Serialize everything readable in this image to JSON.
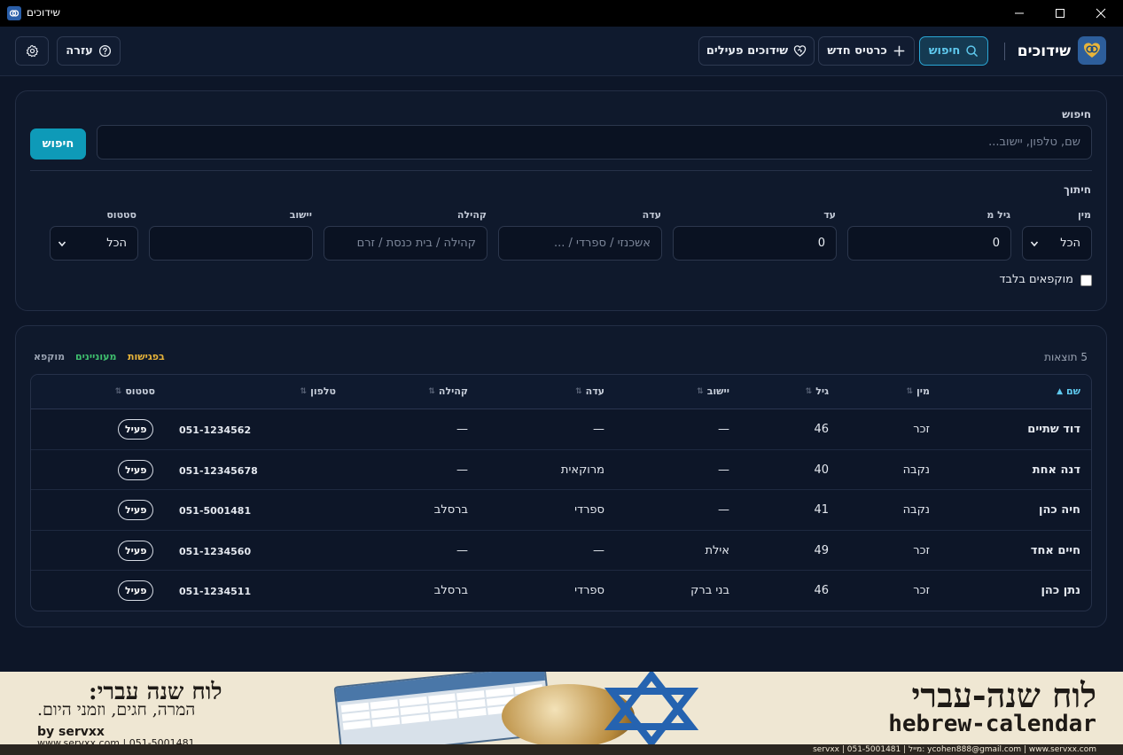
{
  "window": {
    "title": "שידוכים"
  },
  "header": {
    "brand_title": "שידוכים",
    "nav": {
      "search": "חיפוש",
      "new_card": "כרטיס חדש",
      "active_matches": "שידוכים פעילים"
    },
    "help": "עזרה"
  },
  "search": {
    "label": "חיפוש",
    "placeholder": "שם, טלפון, יישוב...",
    "button": "חיפוש"
  },
  "filters": {
    "label": "חיתוך",
    "fields": {
      "gender": {
        "label": "מין",
        "value": "הכל"
      },
      "age_from": {
        "label": "גיל מ",
        "value": "0"
      },
      "age_to": {
        "label": "עד",
        "value": "0"
      },
      "community_origin": {
        "label": "עדה",
        "placeholder": "אשכנזי / ספרדי / ..."
      },
      "congregation": {
        "label": "קהילה",
        "placeholder": "קהילה / בית כנסת / זרם"
      },
      "city": {
        "label": "יישוב",
        "value": ""
      },
      "status": {
        "label": "סטטוס",
        "value": "הכל"
      }
    },
    "frozen_only": "מוקפאים בלבד"
  },
  "results": {
    "count_text": "5 תוצאות",
    "legend": {
      "meeting": "בפגישות",
      "interested": "מעוניינים",
      "frozen": "מוקפא"
    },
    "legend_colors": {
      "meeting": "#e8b43a",
      "interested": "#3fbf6e",
      "frozen": "#9aa3b2"
    },
    "columns": {
      "name": "שם",
      "gender": "מין",
      "age": "גיל",
      "city": "יישוב",
      "origin": "עדה",
      "congregation": "קהילה",
      "phone": "טלפון",
      "status": "סטטוס"
    },
    "rows": [
      {
        "name": "דוד שתיים",
        "gender": "זכר",
        "age": "46",
        "city": "—",
        "origin": "—",
        "congregation": "—",
        "phone": "051-1234562",
        "status": "פעיל"
      },
      {
        "name": "דנה אחת",
        "gender": "נקבה",
        "age": "40",
        "city": "—",
        "origin": "מרוקאית",
        "congregation": "—",
        "phone": "051-12345678",
        "status": "פעיל"
      },
      {
        "name": "חיה כהן",
        "gender": "נקבה",
        "age": "41",
        "city": "—",
        "origin": "ספרדי",
        "congregation": "ברסלב",
        "phone": "051-5001481",
        "status": "פעיל"
      },
      {
        "name": "חיים אחד",
        "gender": "זכר",
        "age": "49",
        "city": "אילת",
        "origin": "—",
        "congregation": "—",
        "phone": "051-1234560",
        "status": "פעיל"
      },
      {
        "name": "נתן כהן",
        "gender": "זכר",
        "age": "46",
        "city": "בני ברק",
        "origin": "ספרדי",
        "congregation": "ברסלב",
        "phone": "051-1234511",
        "status": "פעיל"
      }
    ]
  },
  "banner": {
    "left_title": "לוח שנה עברי:",
    "left_subtitle": "המרה, חגים, וזמני היום.",
    "left_by": "by servxx",
    "left_contact": "www.servxx.com | 051-5001481",
    "right_title": "לוח שנה-עברי",
    "right_subtitle": "hebrew-calendar",
    "footer": "servxx | 051-5001481 | מייל: ycohen888@gmail.com | www.servxx.com"
  }
}
